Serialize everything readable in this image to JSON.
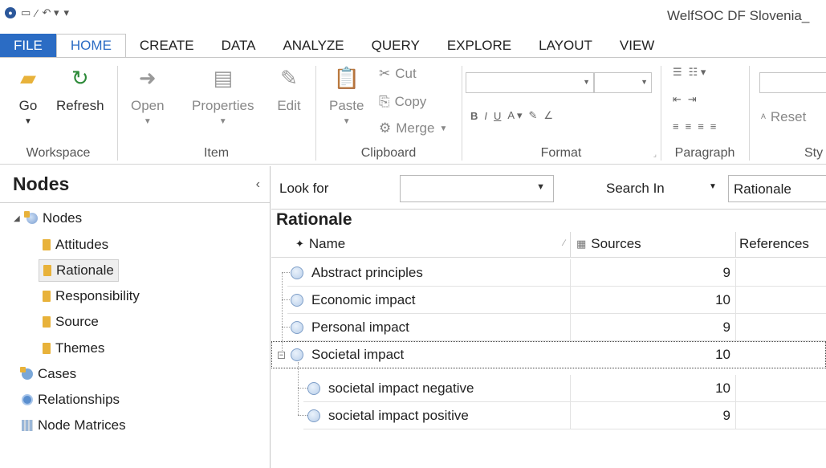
{
  "app": {
    "title": "WelfSOC DF Slovenia_"
  },
  "qat": {
    "icons": [
      "app-icon",
      "save-icon",
      "edit-icon",
      "undo-icon"
    ]
  },
  "tabs": [
    {
      "label": "FILE"
    },
    {
      "label": "HOME"
    },
    {
      "label": "CREATE"
    },
    {
      "label": "DATA"
    },
    {
      "label": "ANALYZE"
    },
    {
      "label": "QUERY"
    },
    {
      "label": "EXPLORE"
    },
    {
      "label": "LAYOUT"
    },
    {
      "label": "VIEW"
    }
  ],
  "ribbon": {
    "workspace": {
      "label": "Workspace",
      "go": "Go",
      "refresh": "Refresh"
    },
    "item": {
      "label": "Item",
      "open": "Open",
      "properties": "Properties",
      "edit": "Edit"
    },
    "clipboard": {
      "label": "Clipboard",
      "paste": "Paste",
      "cut": "Cut",
      "copy": "Copy",
      "merge": "Merge"
    },
    "format": {
      "label": "Format"
    },
    "paragraph": {
      "label": "Paragraph"
    },
    "styles": {
      "label": "Sty",
      "reset": "Reset"
    }
  },
  "nav": {
    "title": "Nodes",
    "root": "Nodes",
    "folders": [
      "Attitudes",
      "Rationale",
      "Responsibility",
      "Source",
      "Themes"
    ],
    "others": [
      "Cases",
      "Relationships",
      "Node Matrices"
    ]
  },
  "find": {
    "look_for": "Look for",
    "search_in": "Search In",
    "search_in_value": "Rationale"
  },
  "list": {
    "title": "Rationale",
    "columns": {
      "name": "Name",
      "sources": "Sources",
      "references": "References"
    },
    "rows": [
      {
        "name": "Abstract principles",
        "sources": "9"
      },
      {
        "name": "Economic impact",
        "sources": "10"
      },
      {
        "name": "Personal impact",
        "sources": "9"
      },
      {
        "name": "Societal impact",
        "sources": "10"
      },
      {
        "name": "societal impact negative",
        "sources": "10"
      },
      {
        "name": "societal impact positive",
        "sources": "9"
      }
    ]
  }
}
